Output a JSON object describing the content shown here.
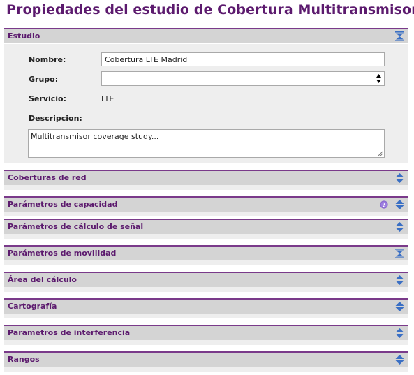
{
  "page": {
    "title": "Propiedades del estudio de Cobertura Multitransmisor"
  },
  "estudio": {
    "header": "Estudio",
    "nombre_label": "Nombre:",
    "nombre_value": "Cobertura LTE Madrid",
    "grupo_label": "Grupo:",
    "grupo_value": "",
    "servicio_label": "Servicio:",
    "servicio_value": "LTE",
    "descripcion_label": "Descripcion:",
    "descripcion_value": "Multitransmisor coverage study..."
  },
  "sections": [
    {
      "label": "Coberturas de red",
      "state": "collapsed"
    },
    {
      "label": "Parámetros de capacidad",
      "state": "collapsed",
      "help": true
    },
    {
      "label": "Parámetros de cálculo de señal",
      "state": "collapsed"
    },
    {
      "label": "Parámetros de movilidad",
      "state": "expanded"
    },
    {
      "label": "Área del cálculo",
      "state": "collapsed"
    },
    {
      "label": "Cartografía",
      "state": "collapsed"
    },
    {
      "label": "Parametros de interferencia",
      "state": "collapsed"
    },
    {
      "label": "Rangos",
      "state": "collapsed"
    }
  ],
  "colors": {
    "accent": "#5c1a6e",
    "icon_blue": "#3a6fc4",
    "header_bg": "#d4d4d4",
    "body_bg": "#eeeeee"
  }
}
